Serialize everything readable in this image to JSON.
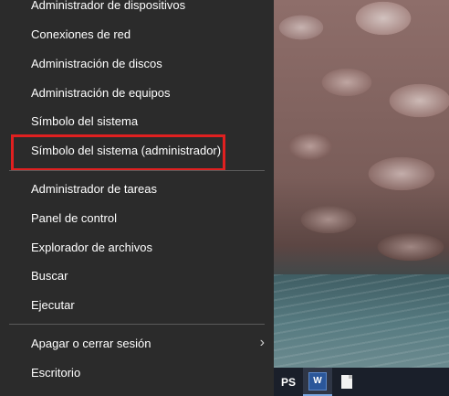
{
  "menu": {
    "items": [
      {
        "label": "Administrador de dispositivos"
      },
      {
        "label": "Conexiones de red"
      },
      {
        "label": "Administración de discos"
      },
      {
        "label": "Administración de equipos"
      },
      {
        "label": "Símbolo del sistema"
      },
      {
        "label": "Símbolo del sistema (administrador)",
        "highlighted": true
      },
      {
        "label": "Administrador de tareas"
      },
      {
        "label": "Panel de control"
      },
      {
        "label": "Explorador de archivos"
      },
      {
        "label": "Buscar"
      },
      {
        "label": "Ejecutar"
      },
      {
        "label": "Apagar o cerrar sesión",
        "has_submenu": true
      },
      {
        "label": "Escritorio"
      }
    ],
    "highlight_color": "#e02020",
    "background_color": "#2b2b2b"
  },
  "taskbar": {
    "icons": [
      {
        "name": "powershell-icon",
        "label": "PS"
      },
      {
        "name": "word-icon",
        "label": "W",
        "active": true
      },
      {
        "name": "file-icon"
      }
    ]
  }
}
